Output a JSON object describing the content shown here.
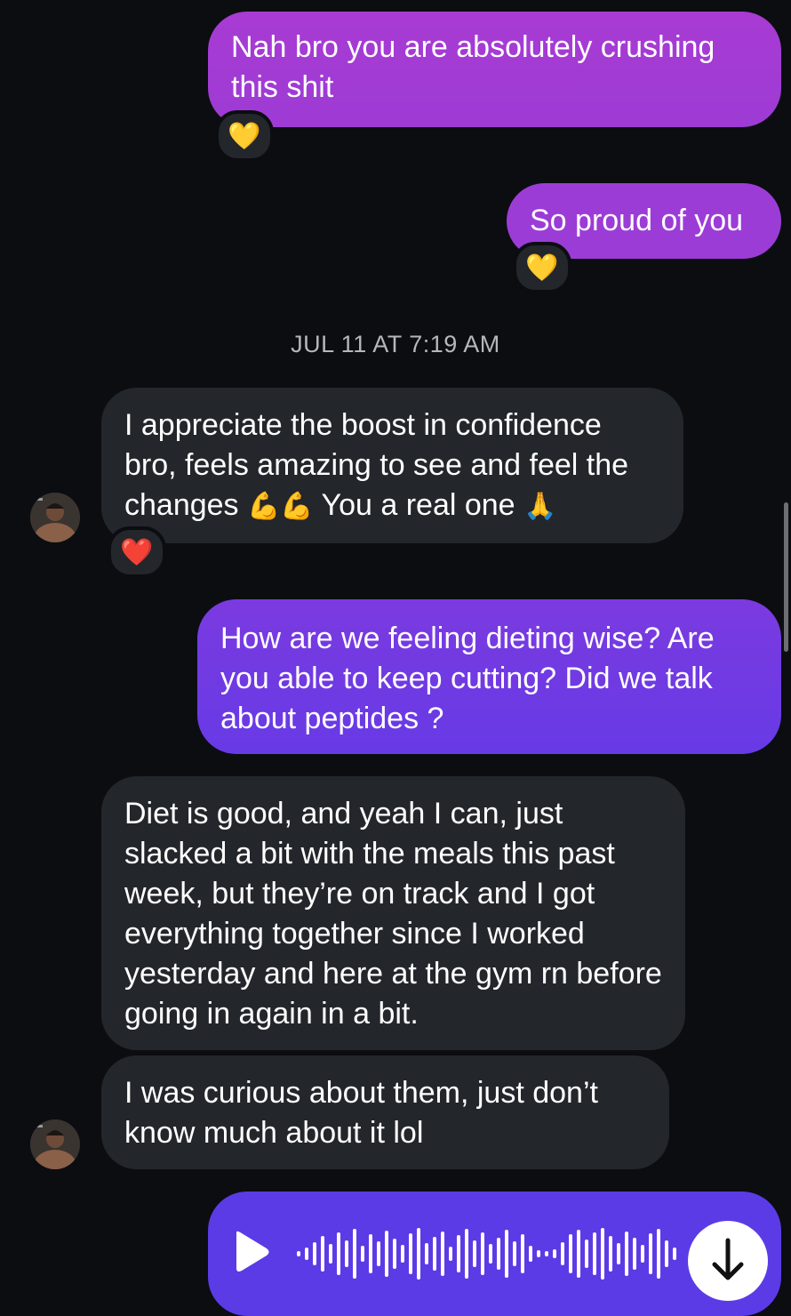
{
  "colors": {
    "background": "#0b0d11",
    "incoming_bubble": "#23262b",
    "outgoing_gradient_top": "#a33bd0",
    "outgoing_gradient_bottom": "#5c3ae6"
  },
  "messages": {
    "m1": {
      "text": "Nah bro you are absolutely crushing this shit",
      "reaction": "💛"
    },
    "m2": {
      "text": "So proud of you",
      "reaction": "💛"
    },
    "timestamp": "JUL 11 AT 7:19 AM",
    "m3": {
      "text_part1": "I appreciate the boost in confidence bro, feels amazing to see and feel the changes ",
      "emoji1": "💪💪",
      "text_part2": " You a real one ",
      "emoji2": "🙏",
      "reaction": "❤️"
    },
    "m4": {
      "text": "How are we feeling dieting wise? Are you able to keep cutting? Did we talk about peptides ?"
    },
    "m5": {
      "text": "Diet is good, and yeah I can, just slacked a bit with the meals this past week, but they’re on track and I got everything together since I worked yesterday and here at the gym rn before going in again in a bit."
    },
    "m6": {
      "text": "I was curious about them, just don’t know much about it lol"
    },
    "voice": {
      "play_icon": "play-icon",
      "download_icon": "arrow-down-icon"
    }
  }
}
